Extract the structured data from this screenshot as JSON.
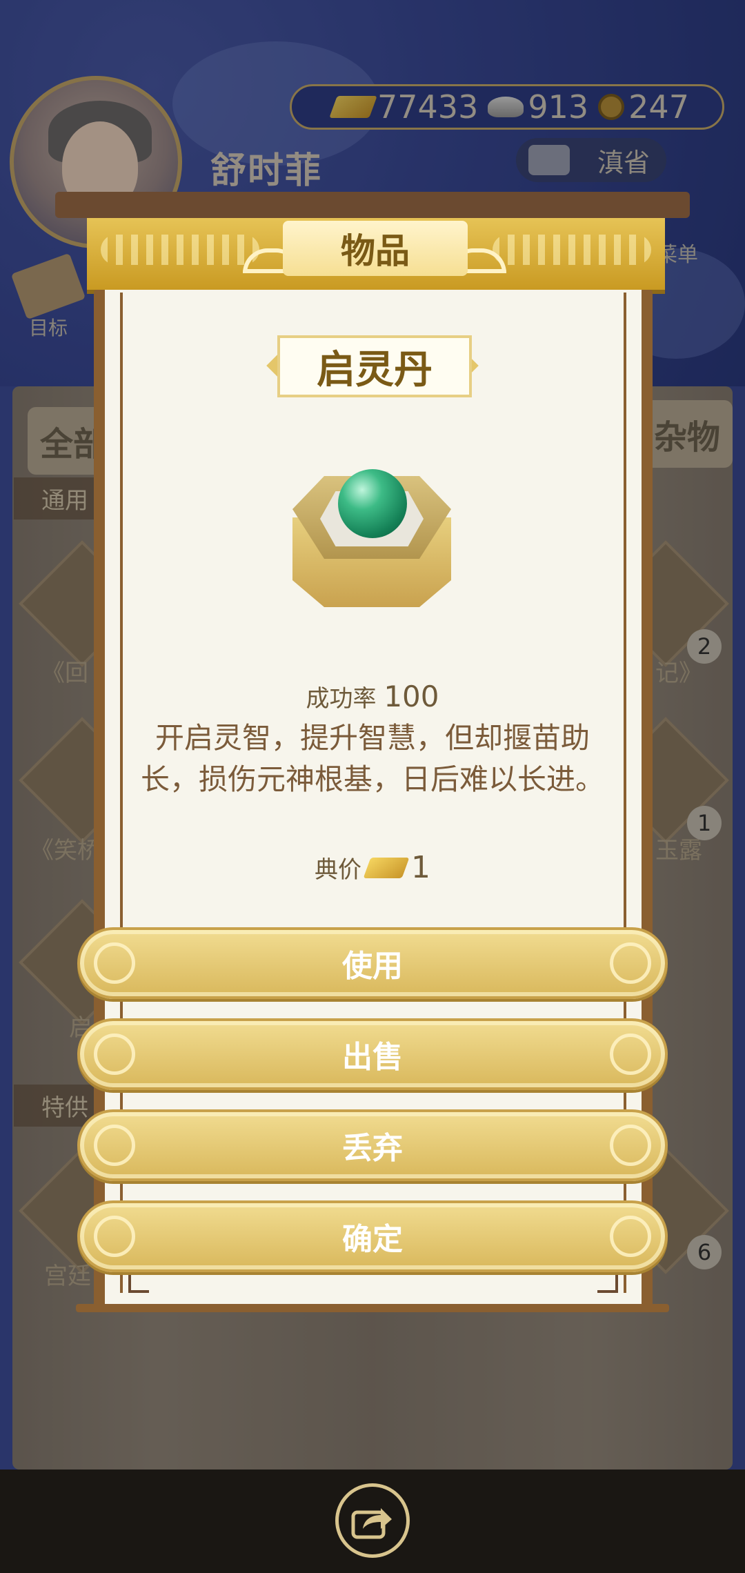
{
  "player": {
    "name": "舒时菲"
  },
  "currency": {
    "gold": "77433",
    "silver": "913",
    "coin": "247"
  },
  "region": "滇省",
  "menu_label": "菜单",
  "goal_label": "目标",
  "background": {
    "tabs": [
      "全部",
      "杂物"
    ],
    "sections": [
      "通用",
      "特供"
    ],
    "items": [
      "《回",
      "记》",
      "《笑桥",
      "玉露",
      "启",
      "宫廷"
    ],
    "badges": [
      "2",
      "1",
      "6"
    ]
  },
  "modal": {
    "header": "物品",
    "item_name": "启灵丹",
    "success_label": "成功率",
    "success_value": "100",
    "description": "开启灵智，提升智慧，但却揠苗助长，损伤元神根基，日后难以长进。",
    "price_label": "典价",
    "price_value": "1",
    "buttons": [
      "使用",
      "出售",
      "丢弃",
      "确定"
    ]
  },
  "colors": {
    "accent_gold": "#d9b85c",
    "text_brown": "#7b5b3a",
    "frame_brown": "#8a5f30"
  }
}
